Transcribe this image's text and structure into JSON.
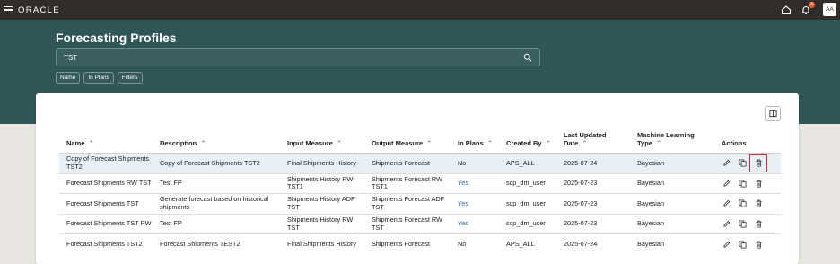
{
  "brand": {
    "logo": "ORACLE"
  },
  "header": {
    "notification_count": "3",
    "avatar_initials": "AA"
  },
  "page": {
    "title": "Forecasting Profiles"
  },
  "search": {
    "value": "TST"
  },
  "filter_chips": [
    {
      "label": "Name"
    },
    {
      "label": "In Plans"
    },
    {
      "label": "Filters"
    }
  ],
  "table": {
    "columns": [
      "Name",
      "Description",
      "Input Measure",
      "Output Measure",
      "In Plans",
      "Created By",
      "Last Updated Date",
      "Machine Learning Type",
      "Actions"
    ],
    "rows": [
      {
        "name": "Copy of Forecast Shipments TST2",
        "description": "Copy of Forecast Shipments TST2",
        "input": "Final Shipments History",
        "output": "Shipments Forecast",
        "in_plans": "No",
        "created_by": "APS_ALL",
        "updated": "2025-07-24",
        "ml_type": "Bayesian"
      },
      {
        "name": "Forecast Shipments RW TST",
        "description": "Test FP",
        "input": "Shipments History RW TST1",
        "output": "Shipments Forecast RW TST1",
        "in_plans": "Yes",
        "created_by": "scp_dm_user",
        "updated": "2025-07-23",
        "ml_type": "Bayesian"
      },
      {
        "name": "Forecast Shipments TST",
        "description": "Generate forecast based on historical shipments",
        "input": "Shipments History ADF TST",
        "output": "Shipments Forecast ADF TST",
        "in_plans": "Yes",
        "created_by": "scp_dm_user",
        "updated": "2025-07-23",
        "ml_type": "Bayesian"
      },
      {
        "name": "Forecast Shipments TST RW",
        "description": "Test FP",
        "input": "Shipments History RW TST",
        "output": "Shipments Forecast RW TST",
        "in_plans": "Yes",
        "created_by": "scp_dm_user",
        "updated": "2025-07-23",
        "ml_type": "Bayesian"
      },
      {
        "name": "Forecast Shipments TST2",
        "description": "Forecast Shipments TEST2",
        "input": "Final Shipments History",
        "output": "Shipments Forecast",
        "in_plans": "No",
        "created_by": "APS_ALL",
        "updated": "2025-07-24",
        "ml_type": "Bayesian"
      }
    ]
  },
  "icons": [
    "menu-icon",
    "home-icon",
    "bell-icon",
    "search-icon",
    "columns-icon",
    "edit-icon",
    "duplicate-icon",
    "delete-icon",
    "sort-icon"
  ],
  "colors": {
    "topbar": "#312d2a",
    "hero": "#2f5556",
    "link": "#2e6fa7",
    "highlight": "#d8262e"
  }
}
